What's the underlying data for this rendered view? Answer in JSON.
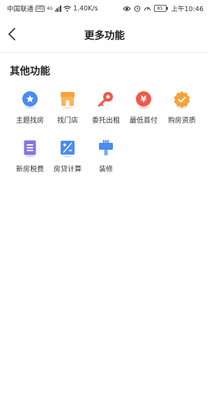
{
  "status_bar": {
    "carrier": "中国联通",
    "hd": "HD",
    "network": "4G",
    "speed": "1.40K/s",
    "battery": "85",
    "time": "上午10:46"
  },
  "nav": {
    "back_label": "",
    "title": "更多功能"
  },
  "section": {
    "title": "其他功能"
  },
  "features": [
    {
      "label": "主题找房",
      "icon": "star-badge-icon",
      "color": "#4a8cf0"
    },
    {
      "label": "找门店",
      "icon": "storefront-icon",
      "color": "#f5a33a"
    },
    {
      "label": "委托出租",
      "icon": "key-icon",
      "color": "#ee5b4c"
    },
    {
      "label": "最低首付",
      "icon": "yen-coin-icon",
      "color": "#ee5b4c"
    },
    {
      "label": "购房资质",
      "icon": "verified-badge-icon",
      "color": "#f5a33a"
    },
    {
      "label": "新房税费",
      "icon": "receipt-icon",
      "color": "#8a73e6"
    },
    {
      "label": "房贷计算",
      "icon": "calculator-icon",
      "color": "#4a8cf0"
    },
    {
      "label": "装修",
      "icon": "paint-roller-icon",
      "color": "#4a8cf0"
    }
  ]
}
